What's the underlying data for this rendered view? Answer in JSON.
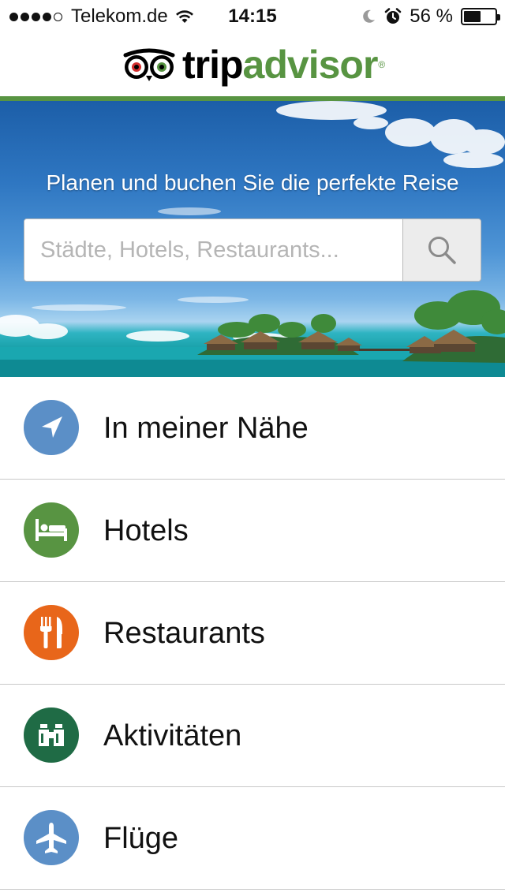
{
  "status_bar": {
    "carrier": "Telekom.de",
    "time": "14:15",
    "battery_percent": "56 %",
    "battery_level": 0.56,
    "signal_bars_filled": 4,
    "signal_bars_total": 5,
    "icons": [
      "wifi-icon",
      "moon-icon",
      "alarm-icon",
      "battery-icon"
    ]
  },
  "header": {
    "logo_trip": "trip",
    "logo_advisor": "advisor",
    "logo_reg": "®",
    "brand_color": "#589442"
  },
  "hero": {
    "title": "Planen und buchen Sie die perfekte Reise",
    "search_placeholder": "Städte, Hotels, Restaurants..."
  },
  "menu": {
    "items": [
      {
        "label": "In meiner Nähe",
        "icon": "location-arrow-icon",
        "color": "#5b8fc7"
      },
      {
        "label": "Hotels",
        "icon": "bed-icon",
        "color": "#589442"
      },
      {
        "label": "Restaurants",
        "icon": "fork-knife-icon",
        "color": "#e8661a"
      },
      {
        "label": "Aktivitäten",
        "icon": "binoculars-icon",
        "color": "#1f6b45"
      },
      {
        "label": "Flüge",
        "icon": "airplane-icon",
        "color": "#5b8fc7"
      }
    ]
  }
}
